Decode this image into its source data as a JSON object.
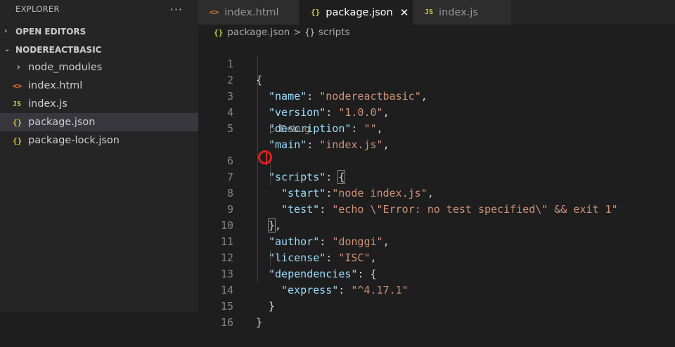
{
  "sidebar": {
    "title": "EXPLORER",
    "more_label": "···",
    "sections": [
      {
        "label": "OPEN EDITORS",
        "chevron": "›"
      },
      {
        "label": "NODEREACTBASIC",
        "chevron": "⌄"
      }
    ],
    "items": [
      {
        "icon": "›",
        "label": "node_modules"
      },
      {
        "icon": "<>",
        "label": "index.html"
      },
      {
        "icon": "JS",
        "label": "index.js"
      },
      {
        "icon": "{}",
        "label": "package.json"
      },
      {
        "icon": "{}",
        "label": "package-lock.json"
      }
    ]
  },
  "tabs": [
    {
      "icon": "<>",
      "label": "index.html"
    },
    {
      "icon": "{}",
      "label": "package.json",
      "close": "✕"
    },
    {
      "icon": "JS",
      "label": "index.js"
    }
  ],
  "breadcrumb": {
    "icon1": "{}",
    "file": "package.json",
    "sep": ">",
    "icon2": "{}",
    "symbol": "scripts"
  },
  "editor": {
    "codelens": "▷ Debug",
    "line_numbers": [
      "1",
      "2",
      "3",
      "4",
      "5",
      "6",
      "7",
      "8",
      "9",
      "10",
      "11",
      "12",
      "13",
      "14",
      "15",
      "16"
    ],
    "lines": {
      "l1": {
        "p1": "{"
      },
      "l2": {
        "k": "\"name\"",
        "p1": ": ",
        "s": "\"nodereactbasic\"",
        "p2": ","
      },
      "l3": {
        "k": "\"version\"",
        "p1": ": ",
        "s": "\"1.0.0\"",
        "p2": ","
      },
      "l4": {
        "k": "\"description\"",
        "p1": ": ",
        "s": "\"\"",
        "p2": ","
      },
      "l5": {
        "k": "\"main\"",
        "p1": ": ",
        "s": "\"index.js\"",
        "p2": ","
      },
      "l6": {
        "k": "\"scripts\"",
        "p1": ": ",
        "p2": "{"
      },
      "l7": {
        "k": "\"start\"",
        "p1": ":",
        "s": "\"node index.js\"",
        "p2": ","
      },
      "l8": {
        "k": "\"test\"",
        "p1": ": ",
        "s": "\"echo \\\"Error: no test specified\\\" && exit 1\""
      },
      "l9": {
        "p1": "}",
        "p2": ","
      },
      "l10": {
        "k": "\"author\"",
        "p1": ": ",
        "s": "\"donggi\"",
        "p2": ","
      },
      "l11": {
        "k": "\"license\"",
        "p1": ": ",
        "s": "\"ISC\"",
        "p2": ","
      },
      "l12": {
        "k": "\"dependencies\"",
        "p1": ": ",
        "p2": "{"
      },
      "l13": {
        "k": "\"express\"",
        "p1": ": ",
        "s": "\"^4.17.1\""
      },
      "l14": {
        "p1": "}"
      },
      "l15": {
        "p1": "}"
      },
      "l16": {}
    }
  },
  "colors": {
    "key": "#9cdcfe",
    "string": "#ce9178",
    "annotation": "#d9231f"
  }
}
